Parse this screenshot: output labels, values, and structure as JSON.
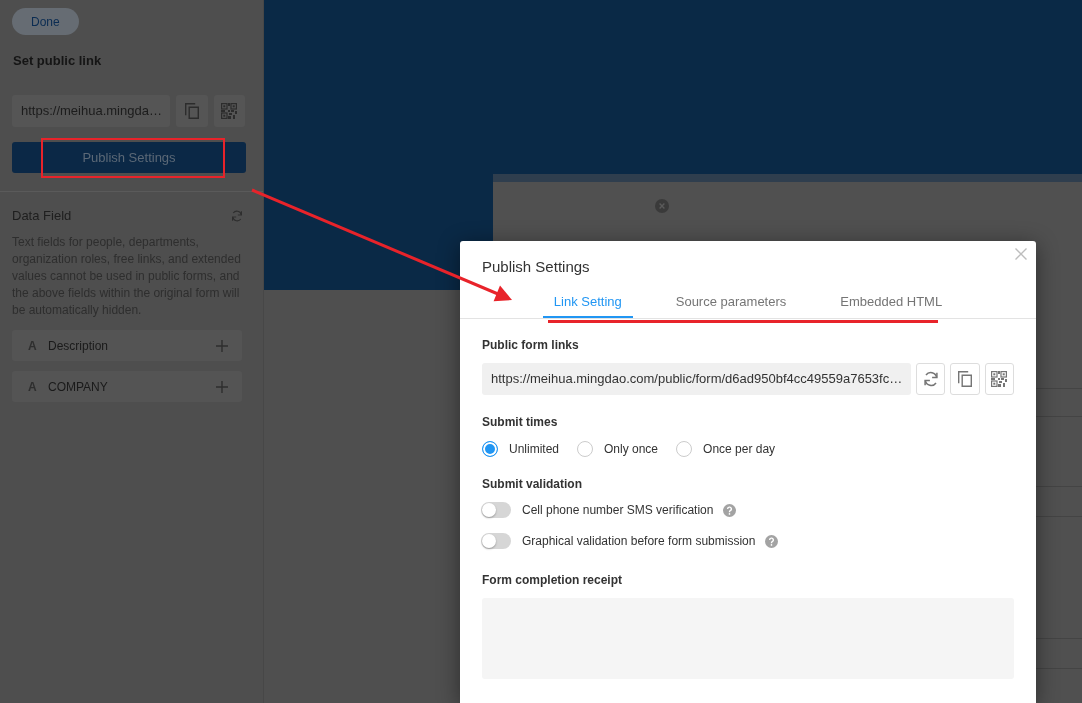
{
  "sidebar": {
    "done_button": "Done",
    "title": "Set public link",
    "link": {
      "value": "https://meihua.mingda…"
    },
    "publish_button": "Publish Settings",
    "data_field": {
      "title": "Data Field",
      "note": "Text fields for people, departments, organization roles, free links, and extended values cannot be used in public forms, and the above fields within the original form will be automatically hidden.",
      "fields": [
        {
          "type_icon": "A",
          "label": "Description"
        },
        {
          "type_icon": "A",
          "label": "COMPANY"
        }
      ]
    }
  },
  "dialog": {
    "title": "Publish Settings",
    "tabs": [
      {
        "label": "Link Setting",
        "selected": true
      },
      {
        "label": "Source parameters",
        "selected": false
      },
      {
        "label": "Embedded HTML",
        "selected": false
      }
    ],
    "public_link": {
      "label": "Public form links",
      "value": "https://meihua.mingdao.com/public/form/d6ad950bf4cc49559a7653fc…"
    },
    "submit_times": {
      "label": "Submit times",
      "options": [
        {
          "label": "Unlimited",
          "selected": true
        },
        {
          "label": "Only once",
          "selected": false
        },
        {
          "label": "Once per day",
          "selected": false
        }
      ]
    },
    "submit_validation": {
      "label": "Submit validation",
      "toggles": [
        {
          "label": "Cell phone number SMS verification",
          "on": false
        },
        {
          "label": "Graphical validation before form submission",
          "on": false
        }
      ]
    },
    "receipt": {
      "label": "Form completion receipt"
    }
  }
}
